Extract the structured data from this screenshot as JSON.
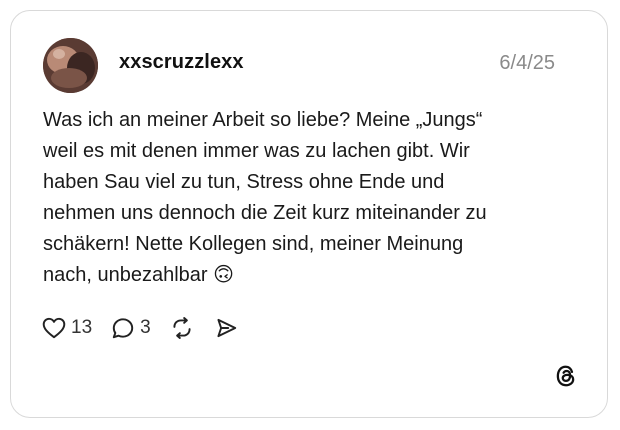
{
  "post": {
    "username": "xxscruzzlexx",
    "date": "6/4/25",
    "text": "Was ich an meiner Arbeit so liebe? Meine „Jungs“\nweil es mit denen immer was zu lachen gibt. Wir\nhaben Sau viel zu tun, Stress ohne Ende und\nnehmen uns dennoch die Zeit kurz miteinander zu\nschäkern! Nette Kollegen sind, meiner Meinung\nnach, unbezahlbar 🙃"
  },
  "actions": {
    "likes": "13",
    "replies": "3"
  },
  "icons": {
    "like": "heart-icon",
    "reply": "speech-bubble-icon",
    "repost": "repost-icon",
    "share": "send-icon",
    "brand": "threads-logo-icon"
  },
  "colors": {
    "border": "#d9d9d9",
    "date": "#8a8a8a",
    "text": "#1a1a1a"
  }
}
